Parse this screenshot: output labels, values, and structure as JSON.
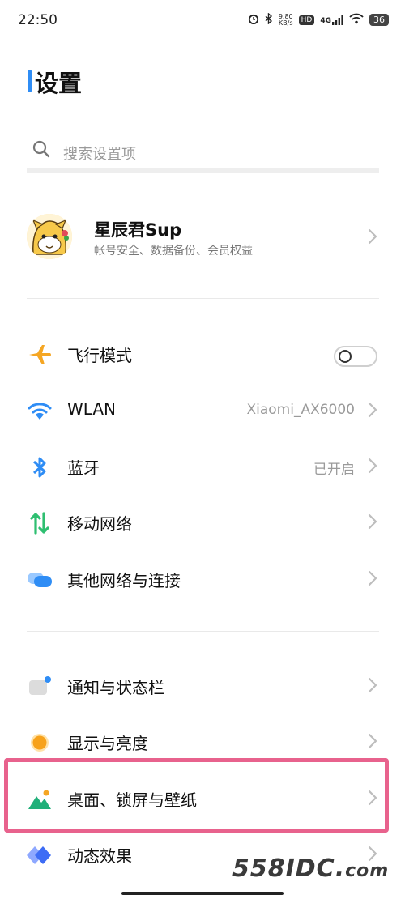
{
  "status_bar": {
    "time": "22:50",
    "net_speed_value": "9.80",
    "net_speed_unit": "KB/s",
    "hd_badge": "HD",
    "network": "4G",
    "battery": "36"
  },
  "page": {
    "title": "设置"
  },
  "search": {
    "placeholder": "搜索设置项"
  },
  "account": {
    "name": "星辰君Sup",
    "subtitle": "帐号安全、数据备份、会员权益"
  },
  "network_items": [
    {
      "label": "飞行模式",
      "icon": "airplane-icon",
      "toggle_on": false
    },
    {
      "label": "WLAN",
      "icon": "wifi-icon",
      "value": "Xiaomi_AX6000"
    },
    {
      "label": "蓝牙",
      "icon": "bluetooth-icon",
      "value": "已开启"
    },
    {
      "label": "移动网络",
      "icon": "mobile-network-icon"
    },
    {
      "label": "其他网络与连接",
      "icon": "connection-icon"
    }
  ],
  "display_items": [
    {
      "label": "通知与状态栏",
      "icon": "notification-icon"
    },
    {
      "label": "显示与亮度",
      "icon": "brightness-icon"
    },
    {
      "label": "桌面、锁屏与壁纸",
      "icon": "wallpaper-icon",
      "highlighted": true
    },
    {
      "label": "动态效果",
      "icon": "animation-icon"
    }
  ],
  "colors": {
    "accent": "#2f8df5",
    "highlight": "#e8628d",
    "airplane": "#f5a623",
    "mobile_network": "#2fbf71"
  },
  "watermark": {
    "main": "558IDC.",
    "suffix": "com"
  }
}
